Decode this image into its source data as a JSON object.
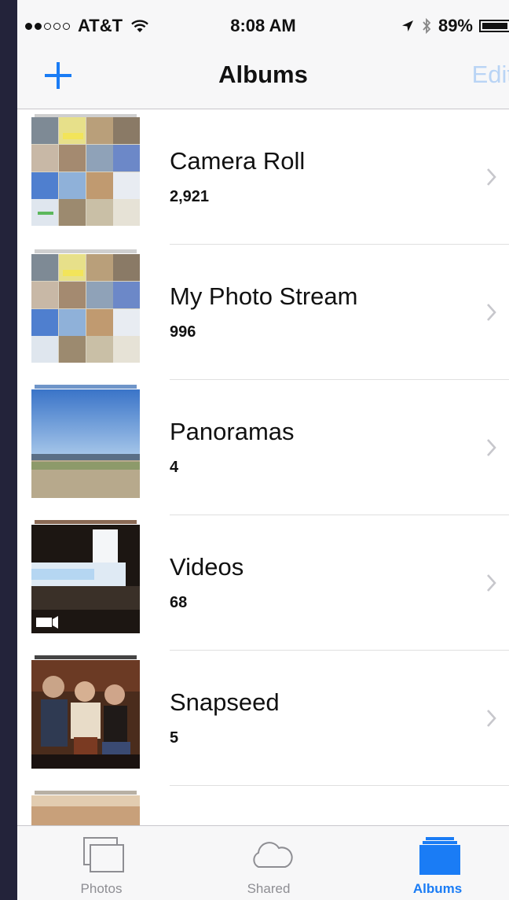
{
  "status_bar": {
    "carrier": "AT&T",
    "signal_bars_on": 2,
    "signal_bars_total": 5,
    "time": "8:08 AM",
    "battery": "89%",
    "battery_level": 0.89
  },
  "nav": {
    "title": "Albums",
    "edit_label": "Edit",
    "add_icon": "plus-icon"
  },
  "albums": [
    {
      "title": "Camera Roll",
      "count": "2,921"
    },
    {
      "title": "My Photo Stream",
      "count": "996"
    },
    {
      "title": "Panoramas",
      "count": "4"
    },
    {
      "title": "Videos",
      "count": "68"
    },
    {
      "title": "Snapseed",
      "count": "5"
    }
  ],
  "tabs": [
    {
      "label": "Photos",
      "icon": "photos-icon",
      "active": false
    },
    {
      "label": "Shared",
      "icon": "cloud-icon",
      "active": false
    },
    {
      "label": "Albums",
      "icon": "albums-icon",
      "active": true
    }
  ],
  "colors": {
    "accent": "#1a7cf5",
    "edit_disabled": "#b9d4f5",
    "tab_inactive": "#8e8e93"
  }
}
